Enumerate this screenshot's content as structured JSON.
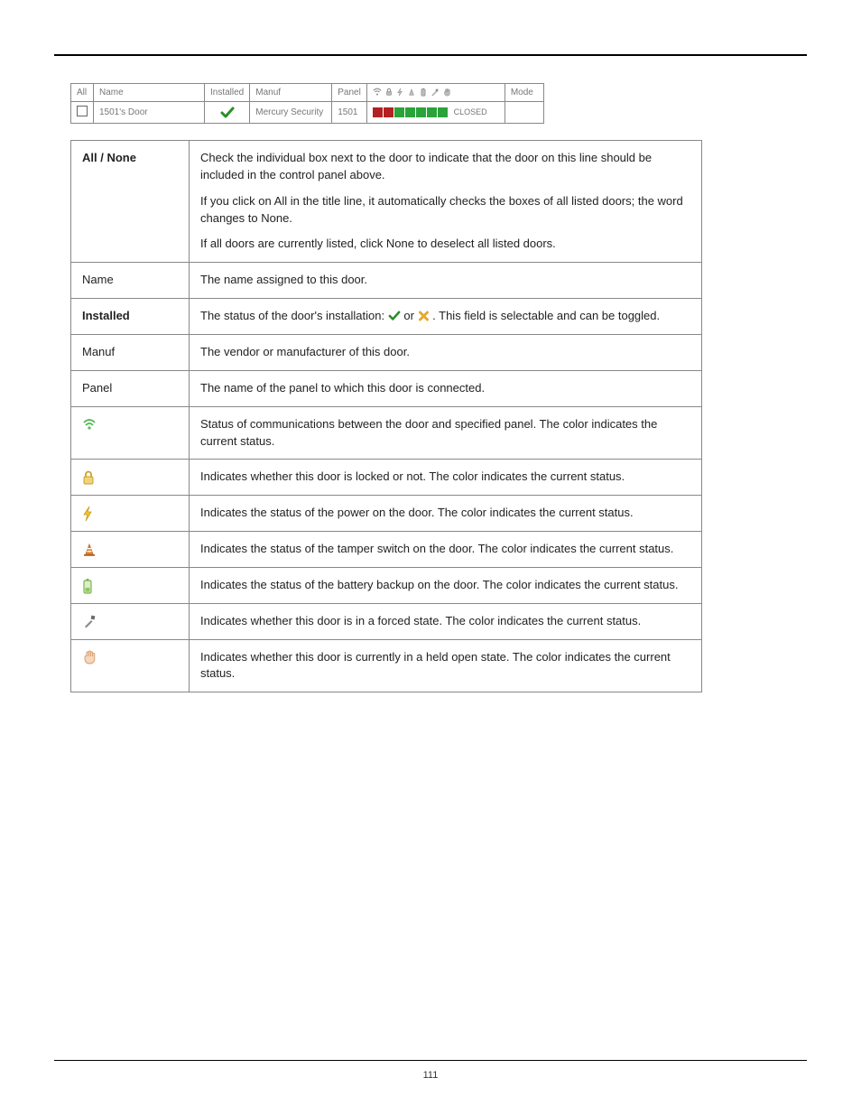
{
  "example_header": {
    "all": "All",
    "name": "Name",
    "installed": "Installed",
    "manuf": "Manuf",
    "panel": "Panel",
    "mode": "Mode"
  },
  "example_row": {
    "name": "1501's Door",
    "manuf": "Mercury Security",
    "panel": "1501",
    "closed": "CLOSED"
  },
  "rows": {
    "all_none_label": "All / None",
    "all_none_p1": "Check the individual box next to the door to indicate that the door on this line should be included in the control panel above.",
    "all_none_p2": "If you click on All in the title line, it automatically checks the boxes of all listed doors; the word changes to None.",
    "all_none_p3": "If all doors are currently listed, click None to deselect all listed doors.",
    "name_label": "Name",
    "name_desc": "The name assigned to this door.",
    "installed_label": "Installed",
    "installed_pre": "The status of the door's installation: ",
    "installed_mid": " or ",
    "installed_post": ". This field is selectable and can be toggled.",
    "manuf_label": "Manuf",
    "manuf_desc": "The vendor or manufacturer of this door.",
    "panel_label": "Panel",
    "panel_desc": "The name of the panel to which this door is connected.",
    "comms_desc": "Status of communications between the door and specified panel. The color indicates the current status.",
    "lock_desc": "Indicates whether this door is locked or not. The color indicates the current status.",
    "power_desc": "Indicates the status of the power on the door. The color indicates the current status.",
    "tamper_desc": "Indicates the status of the tamper switch on the door. The color indicates the current status.",
    "battery_desc": "Indicates the status of the battery backup on the door. The color indicates the current status.",
    "forced_desc": "Indicates whether this door is in a forced state. The color indicates the current status.",
    "held_desc": "Indicates whether this door is currently in a held open state. The color indicates the current status."
  },
  "page_number": "111"
}
